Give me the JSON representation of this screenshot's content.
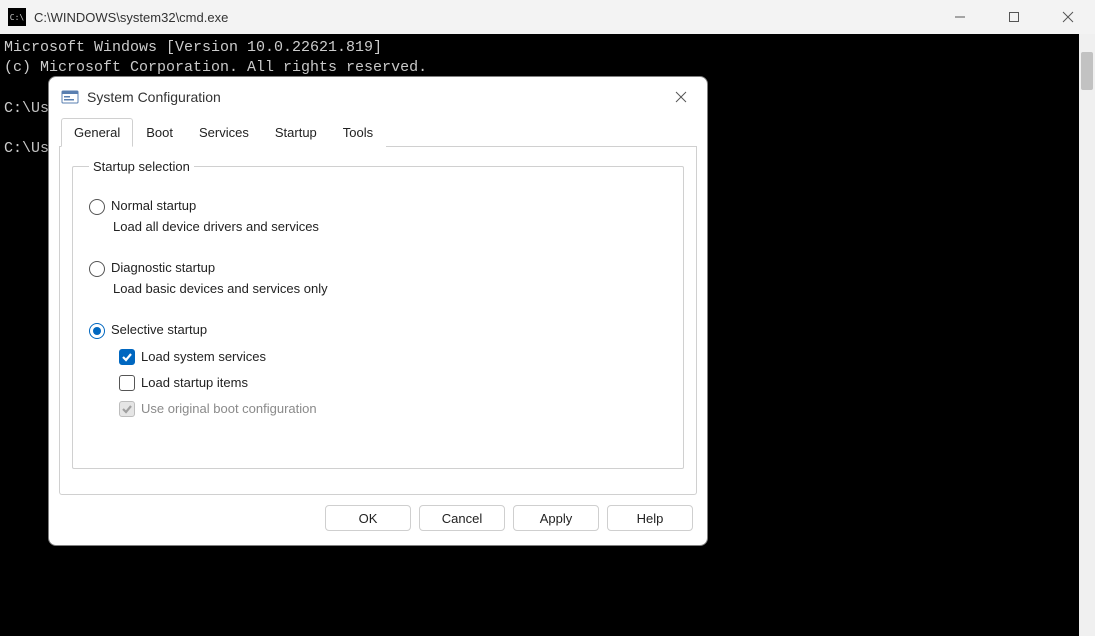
{
  "cmd": {
    "title": "C:\\WINDOWS\\system32\\cmd.exe",
    "icon_label": "cmd-icon",
    "line1": "Microsoft Windows [Version 10.0.22621.819]",
    "line2": "(c) Microsoft Corporation. All rights reserved.",
    "prompt1": "C:\\Use",
    "prompt2": "C:\\Use"
  },
  "dialog": {
    "title": "System Configuration",
    "tabs": {
      "general": "General",
      "boot": "Boot",
      "services": "Services",
      "startup": "Startup",
      "tools": "Tools"
    },
    "group_legend": "Startup selection",
    "normal": {
      "label": "Normal startup",
      "desc": "Load all device drivers and services",
      "checked": false
    },
    "diagnostic": {
      "label": "Diagnostic startup",
      "desc": "Load basic devices and services only",
      "checked": false
    },
    "selective": {
      "label": "Selective startup",
      "checked": true,
      "load_system_label": "Load system services",
      "load_system_checked": true,
      "load_startup_label": "Load startup items",
      "load_startup_checked": false,
      "original_boot_label": "Use original boot configuration",
      "original_boot_checked": true,
      "original_boot_disabled": true
    },
    "buttons": {
      "ok": "OK",
      "cancel": "Cancel",
      "apply": "Apply",
      "help": "Help"
    }
  }
}
